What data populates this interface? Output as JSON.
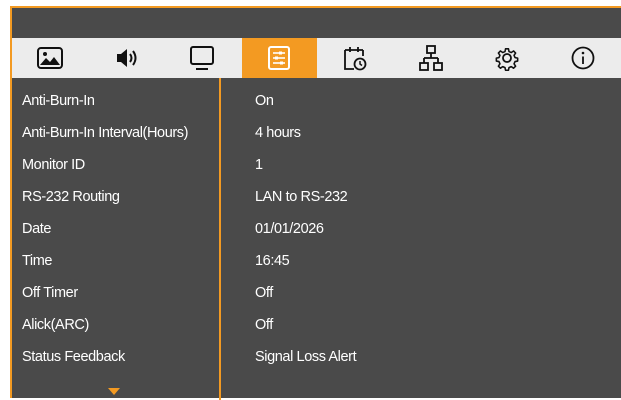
{
  "tabs": [
    {
      "icon": "picture-icon"
    },
    {
      "icon": "speaker-icon"
    },
    {
      "icon": "monitor-icon"
    },
    {
      "icon": "settings-list-icon",
      "active": true
    },
    {
      "icon": "calendar-clock-icon"
    },
    {
      "icon": "network-icon"
    },
    {
      "icon": "gear-icon"
    },
    {
      "icon": "info-icon"
    }
  ],
  "settings": [
    {
      "label": "Anti-Burn-In",
      "value": "On"
    },
    {
      "label": "Anti-Burn-In Interval(Hours)",
      "value": "4 hours"
    },
    {
      "label": "Monitor ID",
      "value": "1"
    },
    {
      "label": "RS-232 Routing",
      "value": "LAN to RS-232"
    },
    {
      "label": "Date",
      "value": "01/01/2026"
    },
    {
      "label": "Time",
      "value": "16:45"
    },
    {
      "label": "Off Timer",
      "value": "Off"
    },
    {
      "label": "Alick(ARC)",
      "value": "Off"
    },
    {
      "label": "Status Feedback",
      "value": "Signal Loss Alert"
    }
  ],
  "colors": {
    "accent": "#f39a22",
    "panel": "#4a4a4a",
    "iconbar": "#ececec",
    "text": "#ffffff"
  }
}
